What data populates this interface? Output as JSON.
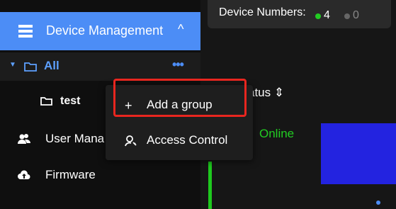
{
  "sidebar": {
    "device_management": "Device Management",
    "tree": {
      "all_label": "All",
      "more": "•••",
      "child_label": "test"
    },
    "user_management": "User Mana",
    "firmware": "Firmware"
  },
  "header": {
    "device_numbers_label": "Device Numbers:",
    "online_count": "4",
    "offline_count": "0",
    "online_color": "#22cc22",
    "offline_color": "#666666"
  },
  "table": {
    "status_header": "atus ⇕",
    "row_status": "Online"
  },
  "context_menu": {
    "items": [
      {
        "icon": "plus-icon",
        "label": "Add a group"
      },
      {
        "icon": "user-key-icon",
        "label": "Access Control"
      }
    ]
  }
}
